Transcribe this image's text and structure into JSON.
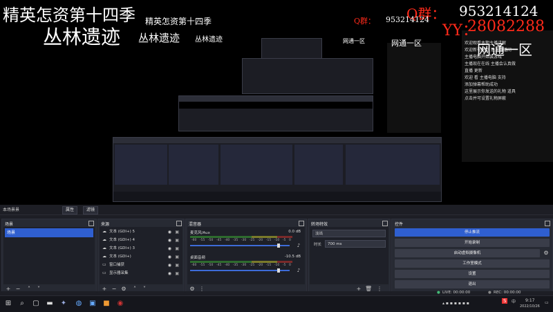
{
  "overlay": {
    "title_left": "精英怎资第十四季",
    "jungle": "丛林遗迹",
    "qq_label": "Q群：",
    "qq_number": "953214124",
    "yy_label": "YY：",
    "yy_number": "28082288",
    "region": "网通一区",
    "nested_jungle_1": "丛林遗迹",
    "nested_jungle_2": "丛林遗迹",
    "nested_title": "精英怎资第十四季"
  },
  "chat_lines": [
    "欢迎观看本期主播讲解",
    "欢迎新号来到 进入直播间",
    "主播电脑开始装游戏",
    "主播现在在线 主播会认真做",
    "直播 更新",
    "欢迎 看 主播电脑 支持",
    "添加弹幕帮助成功",
    "这里展示你发送的礼物 道具",
    "点击并可设置礼物屏蔽"
  ],
  "obs": {
    "scene_label": "本场景景",
    "tab_buttons": [
      "属性",
      "滤镜"
    ],
    "docks": {
      "scenes": {
        "title": "场景",
        "items": [
          "场景"
        ]
      },
      "sources": {
        "title": "来源",
        "items": [
          {
            "icon": "cloud-icon",
            "name": "文本 (GDI+) 5"
          },
          {
            "icon": "cloud-icon",
            "name": "文本 (GDI+) 4"
          },
          {
            "icon": "cloud-icon",
            "name": "文本 (GDI+) 3"
          },
          {
            "icon": "cloud-icon",
            "name": "文本 (GDI+)"
          },
          {
            "icon": "monitor-icon",
            "name": "窗口捕获"
          },
          {
            "icon": "monitor-icon",
            "name": "显示器采集"
          }
        ]
      },
      "mixer": {
        "title": "混音器",
        "channels": [
          {
            "name": "麦克风/Aux",
            "db": "0.0 dB",
            "level": 0.78
          },
          {
            "name": "桌面音频",
            "db": "-10.5 dB",
            "level": 0.78
          }
        ],
        "scale": [
          "-60",
          "-55",
          "-50",
          "-45",
          "-40",
          "-35",
          "-30",
          "-25",
          "-20",
          "-15",
          "-10",
          "-5",
          "0"
        ]
      },
      "transitions": {
        "title": "转场特效",
        "type": "淡出",
        "duration_label": "时长",
        "duration": "700 ms"
      },
      "controls": {
        "title": "控件",
        "buttons": [
          "停止推流",
          "开始录制",
          "启动虚拟摄像机",
          "工作室模式",
          "设置",
          "退出"
        ]
      }
    },
    "status": {
      "live": "LIVE: 00:00:00",
      "rec": "REC: 00:00:00"
    }
  },
  "taskbar": {
    "time": "9:17",
    "date": "2022/10/26",
    "lang": "中",
    "ime": "S"
  },
  "colors": {
    "accent": "#2f5fd0",
    "overlay_red": "#ff2a1a",
    "panel": "#272a33"
  }
}
